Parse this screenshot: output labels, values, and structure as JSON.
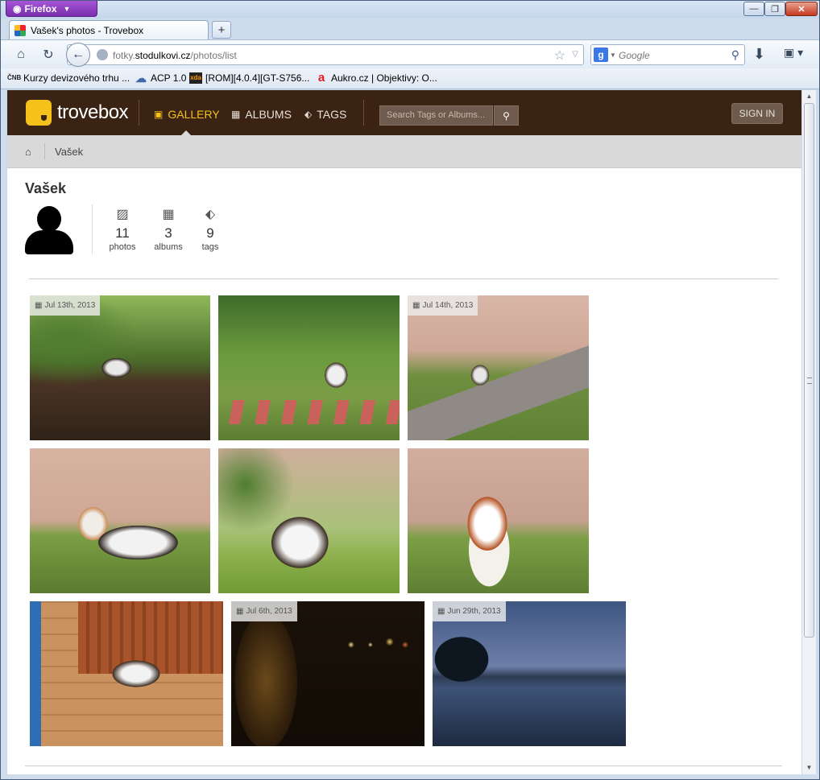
{
  "browser": {
    "menu_button": "Firefox",
    "tab_title": "Vašek's photos - Trovebox",
    "new_tab": "+",
    "url_domain_prefix": "fotky.",
    "url_domain": "stodulkovi.cz",
    "url_path": "/photos/list",
    "search_engine_letter": "g",
    "search_placeholder": "Google",
    "bookmarks": [
      {
        "label": "Kurzy devizového trhu ...",
        "icon": "ČNB"
      },
      {
        "label": "ACP 1.0",
        "icon": "cloud-icon"
      },
      {
        "label": "[ROM][4.0.4][GT-S756...",
        "icon": "xda"
      },
      {
        "label": "Aukro.cz | Objektivy: O...",
        "icon": "a"
      }
    ]
  },
  "site": {
    "brand": "trovebox",
    "nav": {
      "gallery": "GALLERY",
      "albums": "ALBUMS",
      "tags": "TAGS"
    },
    "search_placeholder": "Search Tags or Albums...",
    "sign_in": "SIGN IN",
    "breadcrumb_user": "Vašek",
    "accent_color": "#f5c11a",
    "header_color": "#3b2314"
  },
  "profile": {
    "name": "Vašek",
    "stats": {
      "photos": {
        "count": "11",
        "label": "photos"
      },
      "albums": {
        "count": "3",
        "label": "albums"
      },
      "tags": {
        "count": "9",
        "label": "tags"
      }
    }
  },
  "photos": [
    {
      "date": "Jul 13th, 2013"
    },
    {
      "date": ""
    },
    {
      "date": "Jul 14th, 2013"
    },
    {
      "date": ""
    },
    {
      "date": ""
    },
    {
      "date": ""
    },
    {
      "date": ""
    },
    {
      "date": "Jul 6th, 2013"
    },
    {
      "date": "Jun 29th, 2013"
    }
  ]
}
